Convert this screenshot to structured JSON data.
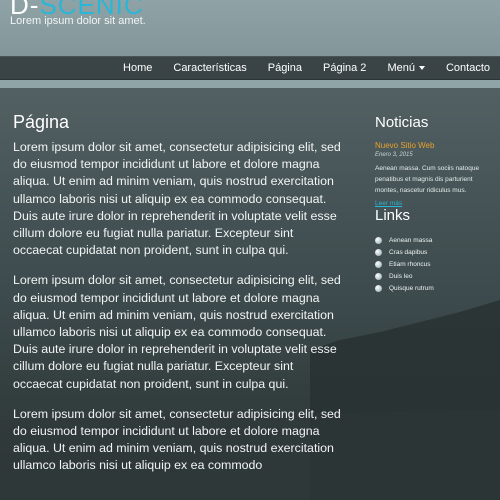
{
  "site": {
    "logo_prefix": "D-",
    "logo_suffix": "SCENIC",
    "tagline": "Lorem ipsum dolor sit amet."
  },
  "nav": {
    "items": [
      "Home",
      "Características",
      "Página",
      "Página 2",
      "Menú",
      "Contacto"
    ]
  },
  "main": {
    "title": "Página",
    "paragraphs": [
      "Lorem ipsum dolor sit amet, consectetur adipisicing elit, sed do eiusmod tempor incididunt ut labore et dolore magna aliqua. Ut enim ad minim veniam, quis nostrud exercitation ullamco laboris nisi ut aliquip ex ea commodo consequat. Duis aute irure dolor in reprehenderit in voluptate velit esse cillum dolore eu fugiat nulla pariatur. Excepteur sint occaecat cupidatat non proident, sunt in culpa qui.",
      "Lorem ipsum dolor sit amet, consectetur adipisicing elit, sed do eiusmod tempor incididunt ut labore et dolore magna aliqua. Ut enim ad minim veniam, quis nostrud exercitation ullamco laboris nisi ut aliquip ex ea commodo consequat. Duis aute irure dolor in reprehenderit in voluptate velit esse cillum dolore eu fugiat nulla pariatur. Excepteur sint occaecat cupidatat non proident, sunt in culpa qui.",
      "Lorem ipsum dolor sit amet, consectetur adipisicing elit, sed do eiusmod tempor incididunt ut labore et dolore magna aliqua. Ut enim ad minim veniam, quis nostrud exercitation ullamco laboris nisi ut aliquip ex ea commodo"
    ]
  },
  "sidebar": {
    "news_heading": "Noticias",
    "news_title": "Nuevo Sitio Web",
    "news_date": "Enero 3, 2015",
    "news_text": "Aenean massa. Cum sociis natoque penatibus et magnis dis parturient montes, nascetur ridiculus mus.",
    "news_more": "Leer más",
    "links_heading": "Links",
    "links": [
      "Aenean massa",
      "Cras dapibus",
      "Etiam rhoncus",
      "Duis leo",
      "Quisque rutrum"
    ]
  },
  "colors": {
    "accent": "#2ab6d6",
    "news_title": "#e8a12b",
    "nav_bg": "#3a4446"
  }
}
